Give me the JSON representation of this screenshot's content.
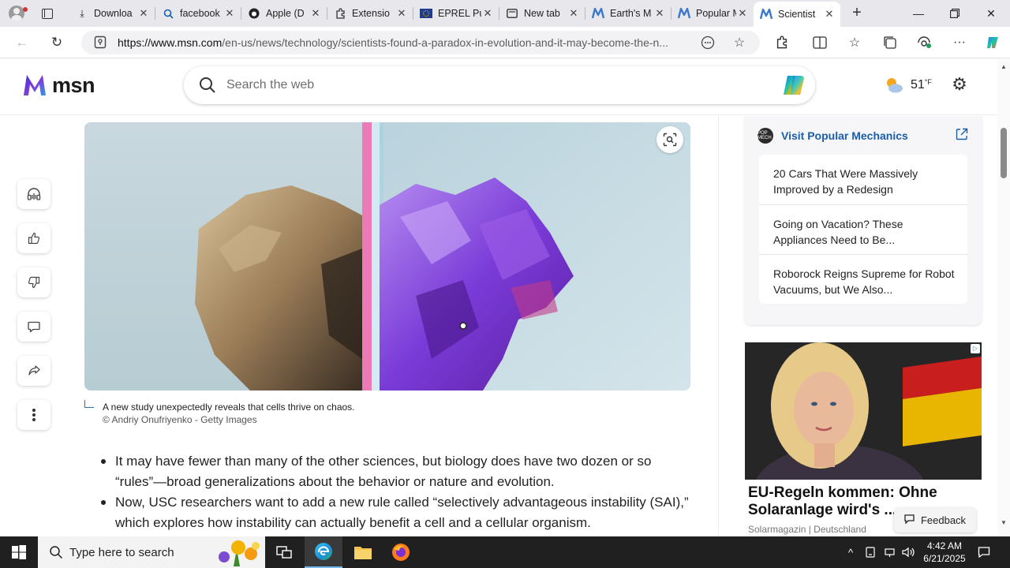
{
  "browser": {
    "tabs": [
      {
        "label": "Downloa",
        "icon": "download-icon"
      },
      {
        "label": "facebook",
        "icon": "search-icon"
      },
      {
        "label": "Apple (D",
        "icon": "apple-icon"
      },
      {
        "label": "Extensio",
        "icon": "extension-icon"
      },
      {
        "label": "EPREL Pu",
        "icon": "eu-flag-icon"
      },
      {
        "label": "New tab",
        "icon": "newtab-icon"
      },
      {
        "label": "Earth's M",
        "icon": "msn-icon"
      },
      {
        "label": "Popular M",
        "icon": "msn-icon"
      },
      {
        "label": "Scientist",
        "icon": "msn-icon"
      }
    ],
    "url_host": "https://www.msn.com",
    "url_path": "/en-us/news/technology/scientists-found-a-paradox-in-evolution-and-it-may-become-the-n..."
  },
  "msn": {
    "logo_text": "msn",
    "search_placeholder": "Search the web",
    "weather_temp": "51",
    "weather_unit": "°F"
  },
  "article": {
    "caption": "A new study unexpectedly reveals that cells thrive on chaos.",
    "credit": "© Andriy Onufriyenko - Getty Images",
    "bullets": [
      "It may have fewer than many of the other sciences, but biology does have two dozen or so “rules”—broad generalizations about the behavior or nature and evolution.",
      "Now, USC researchers want to add a new rule called “selectively advantageous instability (SAI),” which explores how instability can actually benefit a cell and a cellular organism."
    ]
  },
  "sidebar": {
    "source_logo_text": "POP MECH",
    "visit_label": "Visit Popular Mechanics",
    "items": [
      "20 Cars That Were Massively Improved by a Redesign",
      "Going on Vacation? These Appliances Need to Be...",
      "Roborock Reigns Supreme for Robot Vacuums, but We Also..."
    ]
  },
  "ad": {
    "title": "EU-Regeln kommen: Ohne Solaranlage wird's ...",
    "source": "Solarmagazin | Deutschland",
    "feedback_label": "Feedback"
  },
  "taskbar": {
    "search_placeholder": "Type here to search",
    "time": "4:42 AM",
    "date": "6/21/2025"
  },
  "colors": {
    "accent": "#1a5ea8",
    "taskbar": "#202020",
    "tabbar": "#e8e8ec"
  }
}
